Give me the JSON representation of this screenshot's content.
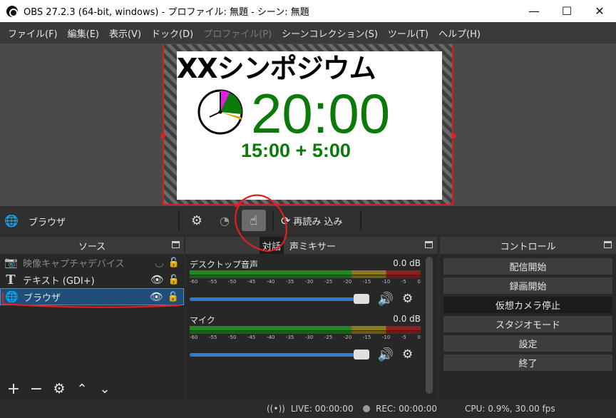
{
  "window": {
    "title": "OBS 27.2.3 (64-bit, windows) - プロファイル: 無題 - シーン: 無題",
    "minimize": "—",
    "maximize": "☐",
    "close": "✕"
  },
  "menu": {
    "items": [
      {
        "label": "ファイル(F)",
        "enabled": true
      },
      {
        "label": "編集(E)",
        "enabled": true
      },
      {
        "label": "表示(V)",
        "enabled": true
      },
      {
        "label": "ドック(D)",
        "enabled": true
      },
      {
        "label": "プロファイル(P)",
        "enabled": false
      },
      {
        "label": "シーンコレクション(S)",
        "enabled": true
      },
      {
        "label": "ツール(T)",
        "enabled": true
      },
      {
        "label": "ヘルプ(H)",
        "enabled": true
      }
    ]
  },
  "preview": {
    "title": "XXシンポジウム",
    "time": "20:00",
    "subtitle": "15:00 + 5:00"
  },
  "context_bar": {
    "source_name": "ブラウザ",
    "refresh_label": "再読み 込み"
  },
  "sources": {
    "header": "ソース",
    "items": [
      {
        "name": "映像キャプチャデバイス",
        "icon": "camera-icon",
        "visible": false
      },
      {
        "name": "テキスト (GDI+)",
        "icon": "text-icon",
        "visible": true
      },
      {
        "name": "ブラウザ",
        "icon": "globe-icon",
        "visible": true,
        "selected": true
      }
    ]
  },
  "mixer": {
    "tab_active": "対話",
    "tab_label": "声ミキサー",
    "channels": [
      {
        "name": "デスクトップ音声",
        "level": "0.0 dB",
        "volume": 1.0
      },
      {
        "name": "マイク",
        "level": "0.0 dB",
        "volume": 1.0
      }
    ],
    "scale": [
      "-60",
      "-55",
      "-50",
      "-45",
      "-40",
      "-35",
      "-30",
      "-25",
      "-20",
      "-15",
      "-10",
      "-5",
      "0"
    ]
  },
  "controls": {
    "header": "コントロール",
    "buttons": [
      {
        "label": "配信開始",
        "active": false
      },
      {
        "label": "録画開始",
        "active": false
      },
      {
        "label": "仮想カメラ停止",
        "active": true
      },
      {
        "label": "スタジオモード",
        "active": false
      },
      {
        "label": "設定",
        "active": false
      },
      {
        "label": "終了",
        "active": false
      }
    ]
  },
  "status": {
    "live": "LIVE: 00:00:00",
    "rec": "REC: 00:00:00",
    "cpu": "CPU: 0.9%, 30.00 fps"
  }
}
